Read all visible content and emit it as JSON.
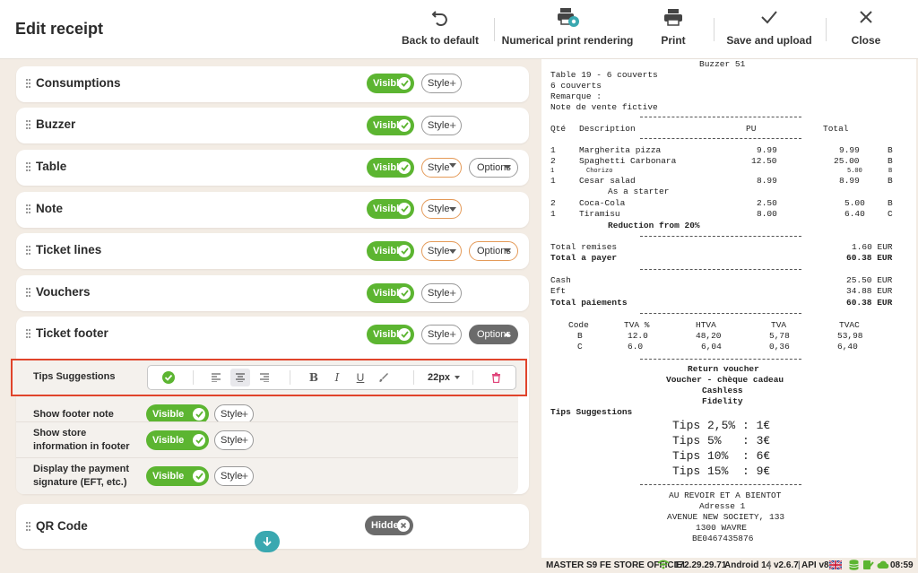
{
  "header": {
    "title": "Edit receipt",
    "back_label": "Back to default",
    "numerical_label": "Numerical print rendering",
    "print_label": "Print",
    "save_label": "Save and upload",
    "close_label": "Close"
  },
  "sections": [
    {
      "name": "Consumptions",
      "visible": "Visible",
      "style": "Style"
    },
    {
      "name": "Buzzer",
      "visible": "Visible",
      "style": "Style"
    },
    {
      "name": "Table",
      "visible": "Visible",
      "style": "Style",
      "options": "Options"
    },
    {
      "name": "Note",
      "visible": "Visible",
      "style": "Style"
    },
    {
      "name": "Ticket lines",
      "visible": "Visible",
      "style": "Style",
      "options": "Options"
    },
    {
      "name": "Vouchers",
      "visible": "Visible",
      "style": "Style"
    },
    {
      "name": "Ticket footer",
      "visible": "Visible",
      "style": "Style",
      "options": "Options"
    },
    {
      "name": "QR Code",
      "hidden": "Hidden"
    }
  ],
  "footer_items": {
    "tips": {
      "label": "Tips Suggestions",
      "font_size": "22px"
    },
    "rows": [
      {
        "label": "Show footer note",
        "visible": "Visible",
        "style": "Style"
      },
      {
        "label": "Show store information in footer",
        "visible": "Visible",
        "style": "Style"
      },
      {
        "label": "Display the payment signature (EFT, etc.)",
        "visible": "Visible",
        "style": "Style"
      }
    ]
  },
  "receipt": {
    "buzzer": "Buzzer 51",
    "table": "Table 19 - 6 couverts",
    "covers": "6 couverts",
    "remark": "Remarque :",
    "note": "Note de vente fictive",
    "headers": {
      "qty": "Qté",
      "desc": "Description",
      "pu": "PU",
      "total": "Total"
    },
    "lines": [
      {
        "qty": "1",
        "desc": "Margherita pizza",
        "pu": "9.99",
        "total": "9.99",
        "code": "B"
      },
      {
        "qty": "2",
        "desc": "Spaghetti Carbonara",
        "pu": "12.50",
        "total": "25.00",
        "code": "B"
      },
      {
        "qty": "1",
        "desc": "Chorizo",
        "pu": "",
        "total": "5.00",
        "code": "B"
      },
      {
        "qty": "1",
        "desc": "Cesar salad",
        "pu": "8.99",
        "total": "8.99",
        "code": "B"
      },
      {
        "qty": "",
        "desc": "As a starter",
        "pu": "",
        "total": "",
        "code": ""
      },
      {
        "qty": "2",
        "desc": "Coca-Cola",
        "pu": "2.50",
        "total": "5.00",
        "code": "B"
      },
      {
        "qty": "1",
        "desc": "Tiramisu",
        "pu": "8.00",
        "total": "6.40",
        "code": "C"
      },
      {
        "qty": "",
        "desc": "Reduction from 20%",
        "pu": "",
        "total": "",
        "code": ""
      }
    ],
    "total_remises_label": "Total remises",
    "total_remises": "1.60 EUR",
    "total_payer_label": "Total a payer",
    "total_payer": "60.38 EUR",
    "cash_label": "Cash",
    "cash": "25.50 EUR",
    "eft_label": "Eft",
    "eft": "34.88 EUR",
    "total_paiements_label": "Total paiements",
    "total_paiements": "60.38 EUR",
    "vat_headers": [
      "Code",
      "TVA %",
      "HTVA",
      "TVA",
      "TVAC"
    ],
    "vat_rows": [
      [
        "B",
        "12.0",
        "48,20",
        "5,78",
        "53,98"
      ],
      [
        "C",
        "6.0",
        "6,04",
        "0,36",
        "6,40"
      ]
    ],
    "payment_types": [
      "Return voucher",
      "Voucher - chèque cadeau",
      "Cashless",
      "Fidelity"
    ],
    "tips_title": "Tips Suggestions",
    "tips": [
      "Tips 2,5% : 1€",
      "Tips 5%   : 3€",
      "Tips 10%  : 6€",
      "Tips 15%  : 9€"
    ],
    "goodbye": "AU REVOIR ET A BIENTOT",
    "address_label": "Adresse 1",
    "street": "AVENUE NEW SOCIETY, 133",
    "city": "1300 WAVRE",
    "vat_number": "BE0467435876"
  },
  "status": {
    "store": "MASTER S9 FE STORE OFFICIEL",
    "ip": "172.29.29.71",
    "android": "Android 14",
    "version": "v2.6.7",
    "api": "API v8",
    "time": "08:59"
  },
  "colors": {
    "visible_green": "#5cb531",
    "highlight_red": "#e0442b",
    "accent_teal": "#3aa8b0",
    "style_orange": "#e49a58"
  }
}
